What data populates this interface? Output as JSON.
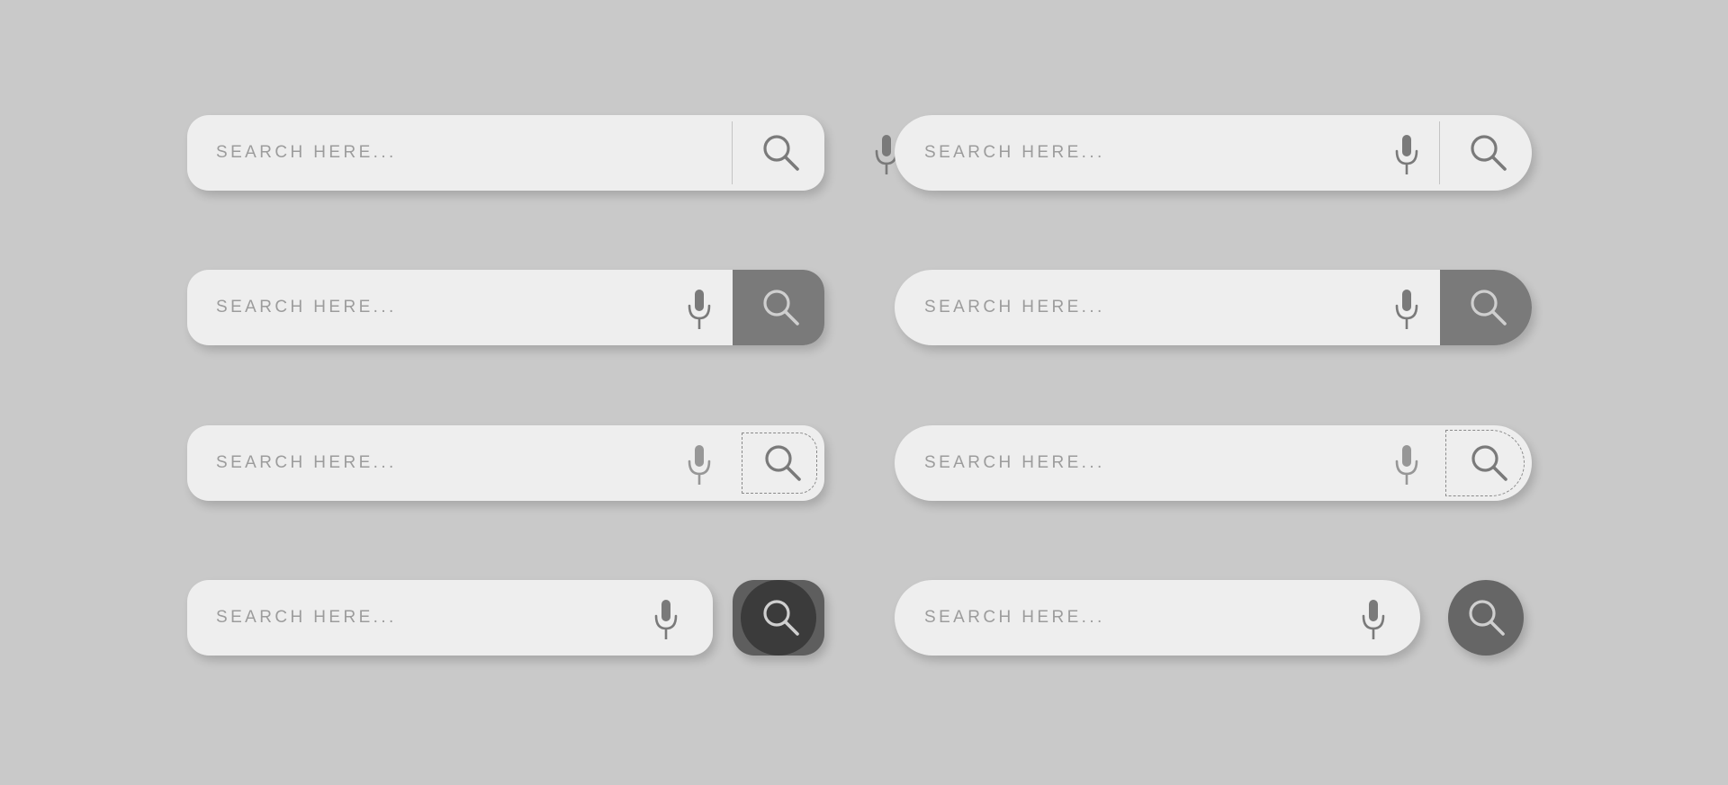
{
  "colors": {
    "background": "#c9c9c9",
    "bar": "#eeeeee",
    "placeholder": "#9c9c9c",
    "icon": "#7a7a7a",
    "filled_button": "#7a7a7a",
    "dark_button": "#5e5e5e",
    "dark_button_inner": "#3b3b3b",
    "circle_button": "#666666"
  },
  "icons": {
    "mic": "microphone-icon",
    "search": "magnifier-icon"
  },
  "search_bars": [
    {
      "placeholder": "SEARCH HERE...",
      "style": "rounded",
      "button": "divider"
    },
    {
      "placeholder": "SEARCH HERE...",
      "style": "pill",
      "button": "divider"
    },
    {
      "placeholder": "SEARCH HERE...",
      "style": "rounded",
      "button": "filled"
    },
    {
      "placeholder": "SEARCH HERE...",
      "style": "pill",
      "button": "filled"
    },
    {
      "placeholder": "SEARCH HERE...",
      "style": "rounded",
      "button": "dashed"
    },
    {
      "placeholder": "SEARCH HERE...",
      "style": "pill",
      "button": "dashed"
    },
    {
      "placeholder": "SEARCH HERE...",
      "style": "rounded",
      "button": "separate-square"
    },
    {
      "placeholder": "SEARCH HERE...",
      "style": "pill",
      "button": "separate-circle"
    }
  ]
}
